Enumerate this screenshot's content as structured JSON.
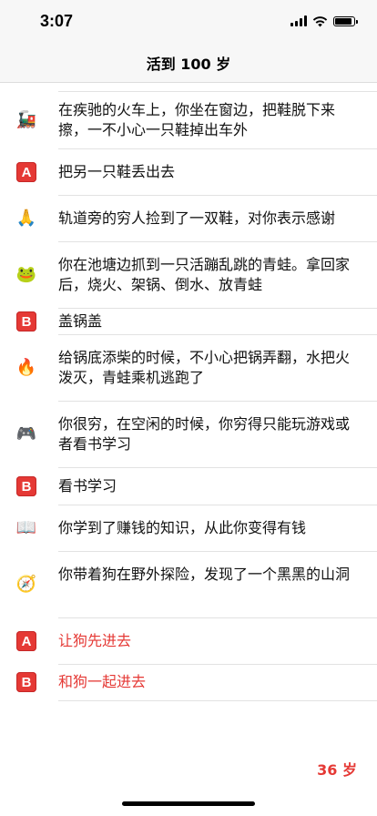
{
  "status_bar": {
    "time": "3:07",
    "battery_level": 0.9
  },
  "nav": {
    "title": "活到 100 岁"
  },
  "events": [
    {
      "icon": "train-icon",
      "glyph": "🚂",
      "text": "在疾驰的火车上，你坐在窗边，把鞋脱下来擦，一不小心一只鞋掉出车外"
    },
    {
      "badge": "A",
      "text": "把另一只鞋丢出去"
    },
    {
      "icon": "folded-hands-icon",
      "glyph": "🙏",
      "text": "轨道旁的穷人捡到了一双鞋，对你表示感谢"
    },
    {
      "icon": "frog-icon",
      "glyph": "🐸",
      "text": "你在池塘边抓到一只活蹦乱跳的青蛙。拿回家后，烧火、架锅、倒水、放青蛙"
    },
    {
      "badge": "B",
      "text": "盖锅盖"
    },
    {
      "icon": "fire-icon",
      "glyph": "🔥",
      "text": "给锅底添柴的时候，不小心把锅弄翻，水把火泼灭，青蛙乘机逃跑了"
    },
    {
      "icon": "game-controller-icon",
      "glyph": "🎮",
      "text": "你很穷，在空闲的时候，你穷得只能玩游戏或者看书学习"
    },
    {
      "badge": "B",
      "text": "看书学习"
    },
    {
      "icon": "open-book-icon",
      "glyph": "📖",
      "text": "你学到了赚钱的知识，从此你变得有钱"
    },
    {
      "icon": "compass-icon",
      "glyph": "🧭",
      "text": "你带着狗在野外探险，发现了一个黑黑的山洞"
    },
    {
      "badge": "A",
      "text": "让狗先进去",
      "highlight": true
    },
    {
      "badge": "B",
      "text": "和狗一起进去",
      "highlight": true
    }
  ],
  "age_label": "36 岁",
  "colors": {
    "accent": "#e53935",
    "nav_background": "#f7f7f7",
    "divider": "#e2e2e2"
  }
}
